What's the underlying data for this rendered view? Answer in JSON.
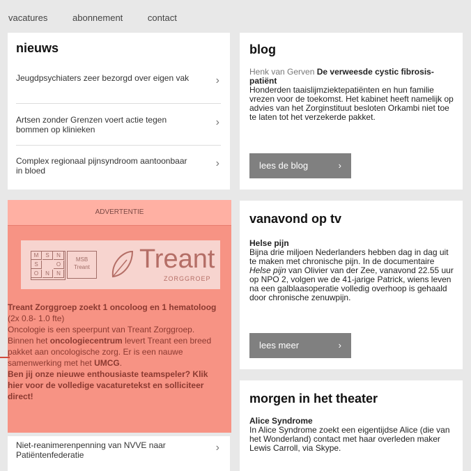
{
  "nav": [
    "vacatures",
    "abonnement",
    "contact"
  ],
  "news": {
    "title": "nieuws",
    "items": [
      "Jeugdpsychiaters zeer bezorgd over eigen vak",
      "Artsen zonder Grenzen voert actie tegen bommen op klinieken",
      "Complex regionaal pijnsyndroom aantoonbaar in bloed"
    ],
    "extra_item": "Niet-reanimerenpenning van NVVE naar Patiëntenfederatie"
  },
  "blog": {
    "title": "blog",
    "author": "Henk van Gerven",
    "headline": "De verweesde cystic fibrosis-patiënt",
    "text": "Honderden taaislijmziektepatiënten en hun familie vrezen voor de toekomst. Het kabinet heeft namelijk op advies van het Zorginstituut besloten Orkambi niet toe te laten tot het verzekerde pakket.",
    "button": "lees de blog"
  },
  "ad": {
    "header": "ADVERTENTIE",
    "grid_letters": [
      "M",
      "S",
      "N",
      "S",
      "O",
      "N",
      "O",
      "N"
    ],
    "msb": "MSB Treant",
    "brand": "Treant",
    "brand_sub": "ZORGGROEP",
    "text_bold1": "Treant Zorggroep zoekt 1 oncoloog en 1 hematoloog",
    "text_normal1": " (2x 0.8- 1.0 fte)",
    "text2": "Oncologie is een speerpunt van Treant Zorggroep. Binnen het ",
    "text2_bold": "oncologiecentrum",
    "text3": " levert Treant een breed pakket aan oncologische zorg. Er is een nauwe samenwerking met het ",
    "text3_bold": "UMCG",
    "text4": ".",
    "text5_bold": "Ben jij onze nieuwe enthousiaste teamspeler? Klik hier voor de volledige vacaturetekst en solliciteer direct!"
  },
  "tv": {
    "title": "vanavond op tv",
    "headline": "Helse pijn",
    "text1": "Bijna drie miljoen Nederlanders hebben dag in dag uit te maken met chronische pijn. In de documentaire ",
    "italic": "Helse pijn",
    "text2": " van Olivier van der Zee, vanavond 22.55 uur op NPO 2, volgen we de 41-jarige Patrick, wiens leven na een galblaasoperatie volledig overhoop is gehaald door chronische zenuwpijn.",
    "button": "lees meer"
  },
  "theater": {
    "title": "morgen in het theater",
    "headline": "Alice Syndrome",
    "text": "In Alice Syndrome zoekt een eigentijdse Alice (die van het Wonderland) contact met haar overleden maker Lewis Carroll, via Skype."
  },
  "chev": "›"
}
